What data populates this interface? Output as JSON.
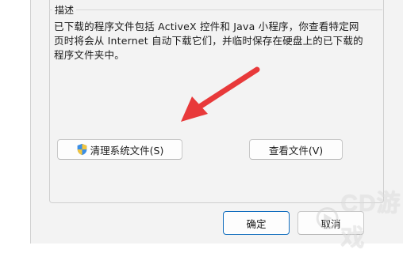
{
  "description_group": {
    "title": "描述",
    "text": "已下载的程序文件包括 ActiveX 控件和 Java 小程序，你查看特定网页时将会从 Internet 自动下载它们，并临时保存在硬盘上的已下载的程序文件夹中。"
  },
  "buttons": {
    "clean_system_files": "清理系统文件(S)",
    "view_files": "查看文件(V)",
    "ok": "确定",
    "cancel": "取消"
  },
  "annotation": {
    "arrow_color": "#e8393a"
  },
  "watermark": {
    "text": "CD游戏"
  },
  "colors": {
    "dialog_background": "#f3f3f3",
    "accent": "#0f6cbd"
  }
}
